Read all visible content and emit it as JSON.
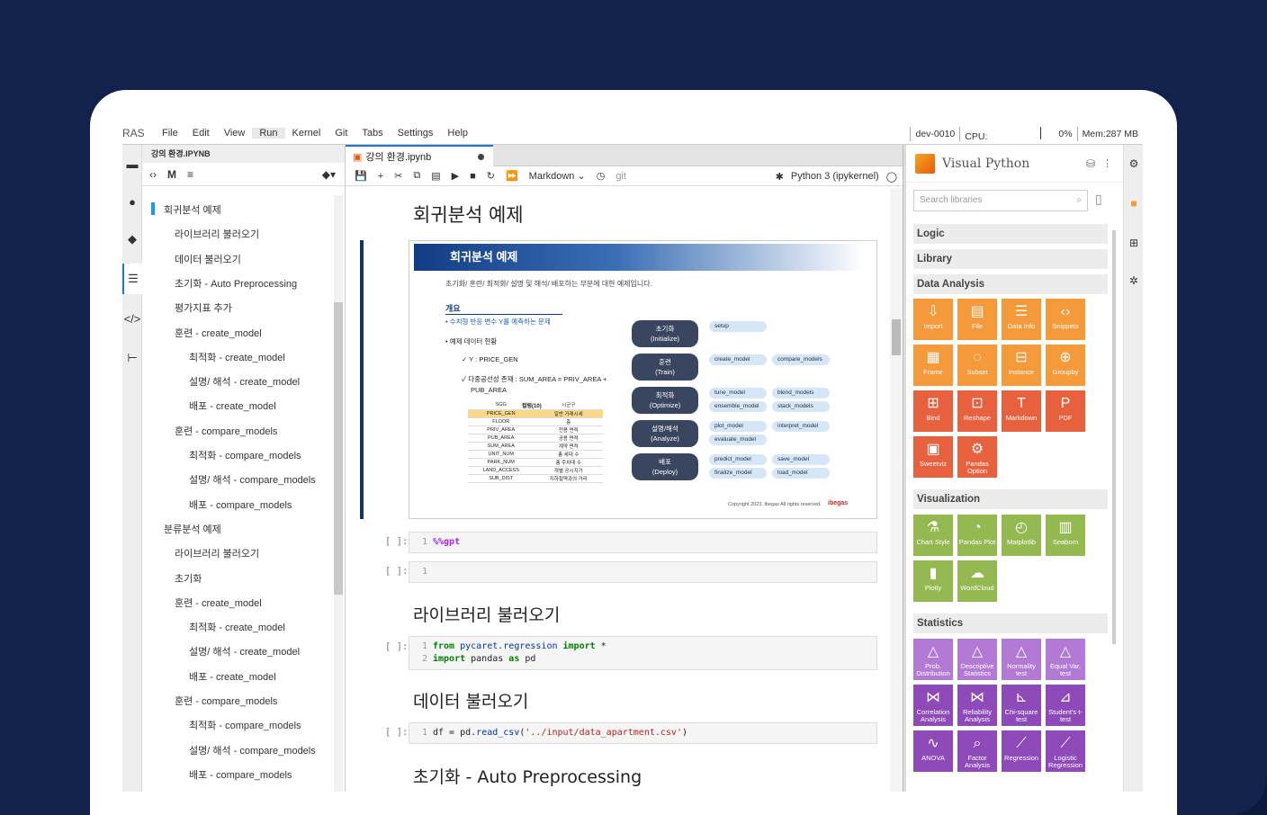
{
  "menu": {
    "logo": "RAS",
    "items": [
      "File",
      "Edit",
      "View",
      "Run",
      "Kernel",
      "Git",
      "Tabs",
      "Settings",
      "Help"
    ],
    "active": "Run"
  },
  "status": {
    "server": "dev-0010",
    "cpu_label": "CPU:",
    "cpu_pct": "0%",
    "mem": "Mem:287 MB"
  },
  "toc": {
    "title": "강의 환경.IPYNB",
    "items": [
      {
        "label": "회귀분석 예제",
        "level": 1
      },
      {
        "label": "라이브러리 불러오기",
        "level": 2
      },
      {
        "label": "데이터 불러오기",
        "level": 2
      },
      {
        "label": "초기화 - Auto Preprocessing",
        "level": 2
      },
      {
        "label": "평가지표 추가",
        "level": 2
      },
      {
        "label": "훈련 - create_model",
        "level": 2
      },
      {
        "label": "최적화 - create_model",
        "level": 3
      },
      {
        "label": "설명/ 해석 - create_model",
        "level": 3
      },
      {
        "label": "배포 - create_model",
        "level": 3
      },
      {
        "label": "훈련 - compare_models",
        "level": 2
      },
      {
        "label": "최적화 - compare_models",
        "level": 3
      },
      {
        "label": "설명/ 해석 - compare_models",
        "level": 3
      },
      {
        "label": "배포 - compare_models",
        "level": 3
      },
      {
        "label": "분류분석 예제",
        "level": 1
      },
      {
        "label": "라이브러리 불러오기",
        "level": 2
      },
      {
        "label": "초기화",
        "level": 2
      },
      {
        "label": "훈련 - create_model",
        "level": 2
      },
      {
        "label": "최적화 - create_model",
        "level": 3
      },
      {
        "label": "설명/ 해석 - create_model",
        "level": 3
      },
      {
        "label": "배포 - create_model",
        "level": 3
      },
      {
        "label": "훈련 - compare_models",
        "level": 2
      },
      {
        "label": "최적화 - compare_models",
        "level": 3
      },
      {
        "label": "설명/ 해석 - compare_models",
        "level": 3
      },
      {
        "label": "배포 - compare_models",
        "level": 3
      }
    ]
  },
  "notebook": {
    "tab": "강의 환경.ipynb",
    "cell_type": "Markdown",
    "git": "git",
    "kernel": "Python 3 (ipykernel)",
    "h_regression": "회귀분석 예제",
    "h_library": "라이브러리 불러오기",
    "h_data": "데이터 불러오기",
    "h_init": "초기화 - Auto Preprocessing",
    "prompt": "[ ]:",
    "cell1": "%%gpt",
    "cell3_line1_kw": "from",
    "cell3_line1_mod": " pycaret.regression ",
    "cell3_line1_kw2": "import",
    "cell3_line1_rest": " *",
    "cell3_line2_kw": "import",
    "cell3_line2_mod": " pandas ",
    "cell3_line2_kw2": "as",
    "cell3_line2_rest": " pd",
    "cell4_a": "df = pd.",
    "cell4_fn": "read_csv",
    "cell4_b": "(",
    "cell4_str": "'../input/data_apartment.csv'",
    "cell4_c": ")"
  },
  "slide": {
    "title": "회귀분석 예제",
    "subtitle": "초기화/ 훈련/ 최적화/ 설명 및 해석/ 배포하는 부분에 대한 예제입니다.",
    "overview": "개요",
    "b1": "• 수치형 반응 변수 Y를 예측하는 문제",
    "b2": "• 예제 데이터 현황",
    "b3": "✓ Y : PRICE_GEN",
    "b4": "✓ 다중공선성 존재 : SUM_AREA = PRIV_AREA +",
    "b5": "PUB_AREA",
    "table_head": "컬럼(10)",
    "table_rows": [
      [
        "SGG",
        "시군구"
      ],
      [
        "PRICE_GEN",
        "일반 거래시세"
      ],
      [
        "FLOOR",
        "층"
      ],
      [
        "PRIV_AREA",
        "전용 면적"
      ],
      [
        "PUB_AREA",
        "공용 면적"
      ],
      [
        "SUM_AREA",
        "계약 면적"
      ],
      [
        "UNIT_NUM",
        "총 세대 수"
      ],
      [
        "PARK_NUM",
        "총 주차대 수"
      ],
      [
        "LAND_ACCESS",
        "개별 공시지가"
      ],
      [
        "SUB_DIST",
        "지하철역과의 거리"
      ]
    ],
    "steps": [
      {
        "a": "초기화",
        "b": "(Initialize)",
        "tags": [
          "setup"
        ]
      },
      {
        "a": "훈련",
        "b": "(Train)",
        "tags": [
          "create_model",
          "compare_models"
        ]
      },
      {
        "a": "최적화",
        "b": "(Optimize)",
        "tags": [
          "tune_model",
          "blend_models",
          "ensemble_model",
          "stack_models"
        ]
      },
      {
        "a": "설명/해석",
        "b": "(Analyze)",
        "tags": [
          "plot_model",
          "interpret_model",
          "evaluate_model"
        ]
      },
      {
        "a": "배포",
        "b": "(Deploy)",
        "tags": [
          "predict_model",
          "save_model",
          "finalize_model",
          "load_model"
        ]
      }
    ],
    "copyright": "Copyright 2023. Ibegas All rights reserved.",
    "brand": "ibegas"
  },
  "vp": {
    "title": "Visual Python",
    "search_placeholder": "Search libraries",
    "sec_logic": "Logic",
    "sec_library": "Library",
    "sec_data": "Data Analysis",
    "sec_vis": "Visualization",
    "sec_stats": "Statistics",
    "data_buttons": [
      "Import",
      "File",
      "Data Info",
      "Snippets",
      "Frame",
      "Subset",
      "Instance",
      "Groupby",
      "Bind",
      "Reshape",
      "Markdown",
      "PDF",
      "Sweetviz",
      "Pandas Option"
    ],
    "vis_buttons": [
      "Chart Style",
      "Pandas Plot",
      "Matplotlib",
      "Seaborn",
      "Plotly",
      "WordCloud"
    ],
    "stat_buttons": [
      "Prob. Distribution",
      "Descriptive Statistics",
      "Normality test",
      "Equal Var. test",
      "Correlation Analysis",
      "Reliability Analysis",
      "Chi-square test",
      "Student's t-test",
      "ANOVA",
      "Factor Analysis",
      "Regression",
      "Logistic Regression"
    ]
  }
}
